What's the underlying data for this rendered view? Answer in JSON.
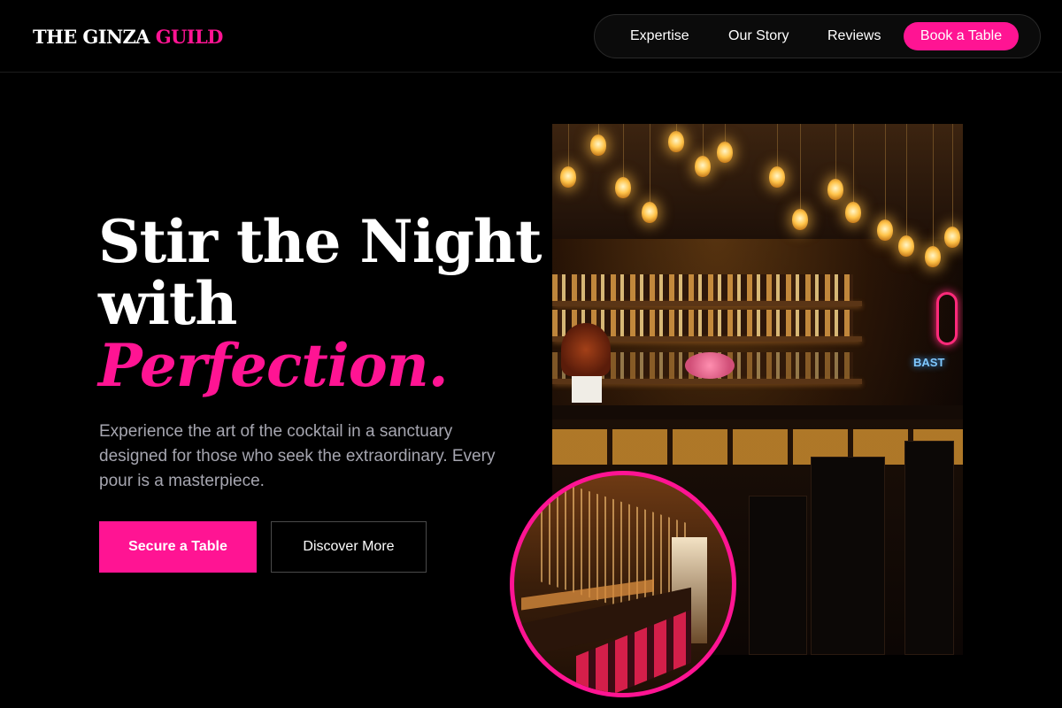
{
  "brand": {
    "name_part1": "THE GINZA",
    "name_part2": "GUILD"
  },
  "nav": {
    "items": [
      {
        "label": "Expertise"
      },
      {
        "label": "Our Story"
      },
      {
        "label": "Reviews"
      }
    ],
    "cta_label": "Book a Table"
  },
  "hero": {
    "title_line1": "Stir the Night",
    "title_line2": "with",
    "title_accent": "Perfection.",
    "description": "Experience the art of the cocktail in a sanctuary designed for those who seek the extraordinary. Every pour is a masterpiece.",
    "primary_button": "Secure a Table",
    "secondary_button": "Discover More"
  },
  "images": {
    "main": "bar-interior-photo",
    "inset": "bar-corridor-photo",
    "neon_text": "BAST"
  },
  "colors": {
    "accent": "#ff1493",
    "background": "#000000",
    "text_muted": "#a6a6b0"
  }
}
